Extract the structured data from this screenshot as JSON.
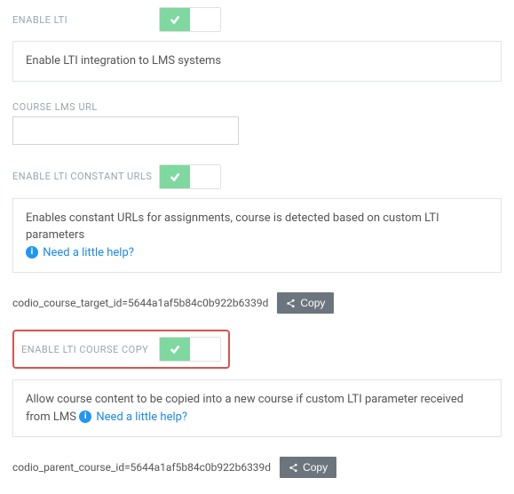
{
  "enable_lti": {
    "label": "ENABLE LTI",
    "description": "Enable LTI integration to LMS systems"
  },
  "course_lms_url": {
    "label": "COURSE LMS URL",
    "value": ""
  },
  "enable_constant_urls": {
    "label": "ENABLE LTI CONSTANT URLS",
    "description": "Enables constant URLs for assignments, course is detected based on custom LTI parameters",
    "help_text": "Need a little help?"
  },
  "course_target_id": {
    "text": "codio_course_target_id=5644a1af5b84c0b922b6339d",
    "copy_label": "Copy"
  },
  "enable_course_copy": {
    "label": "ENABLE LTI COURSE COPY",
    "description": "Allow course content to be copied into a new course if custom LTI parameter received from LMS",
    "help_text": "Need a little help?"
  },
  "parent_course_id": {
    "text": "codio_parent_course_id=5644a1af5b84c0b922b6339d",
    "copy_label": "Copy"
  }
}
